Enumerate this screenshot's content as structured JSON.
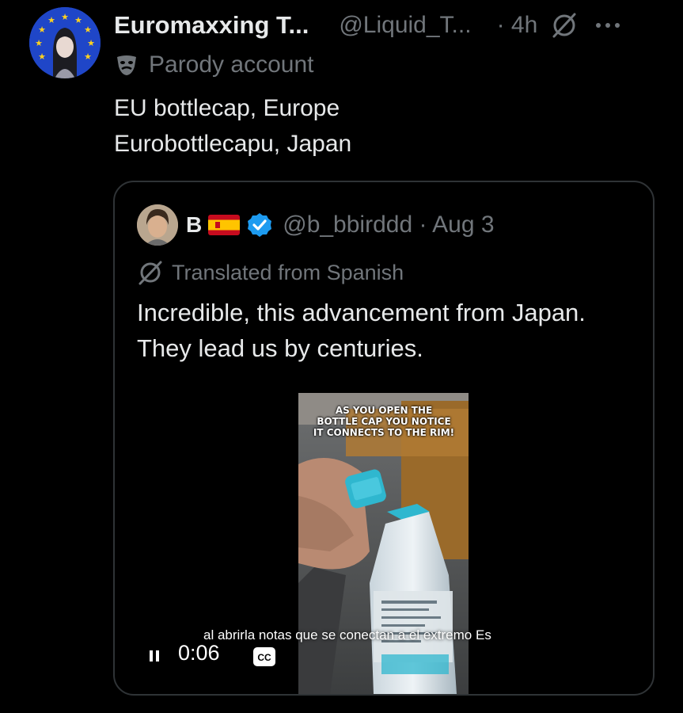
{
  "post": {
    "display_name": "Euromaxxing T...",
    "handle": "@Liquid_T...",
    "time": "· 4h",
    "parody_label": "Parody account",
    "text_line1": "EU bottlecap, Europe",
    "text_line2": "Eurobottlecapu, Japan"
  },
  "quote": {
    "display_name": "B",
    "handle_time": "@b_bbirddd · Aug 3",
    "translated_label": "Translated from Spanish",
    "text_line1": "Incredible, this advancement from Japan.",
    "text_line2": "They lead us by centuries."
  },
  "video": {
    "overlay_line1": "AS YOU OPEN THE",
    "overlay_line2": "BOTTLE CAP YOU NOTICE",
    "overlay_line3": "IT CONNECTS TO THE RIM!",
    "subtitle": "al abrirla notas que se conectan a el extremo Es",
    "elapsed": "0:06",
    "cc_label": "CC"
  },
  "colors": {
    "background": "#000000",
    "text": "#e7e9ea",
    "secondary": "#71767b",
    "border": "#2f3336",
    "verified": "#1d9bf0",
    "bottle_cap": "#2fb7cf"
  },
  "icons": [
    "grok-icon",
    "more-icon",
    "parody-mask-icon",
    "spain-flag-icon",
    "verified-badge-icon",
    "translate-icon",
    "pause-icon",
    "closed-captions-icon"
  ]
}
